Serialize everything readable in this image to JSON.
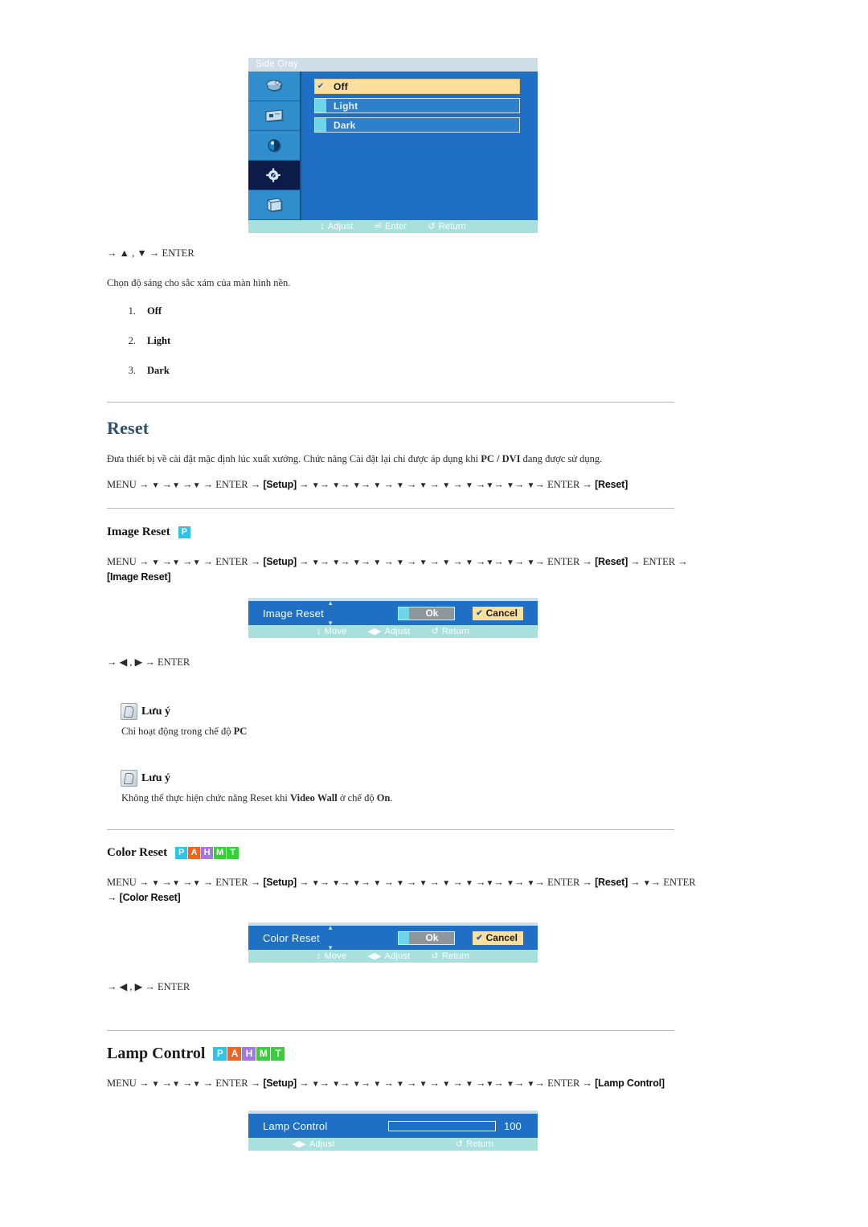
{
  "osd_side_gray": {
    "title": "Side Gray",
    "sidebar_icons": [
      "picture-icon",
      "display-icon",
      "color-icon",
      "setup-gear-icon",
      "multi-control-icon"
    ],
    "options": [
      {
        "label": "Off",
        "selected": true,
        "check": "✔"
      },
      {
        "label": "Light",
        "selected": false,
        "check": ""
      },
      {
        "label": "Dark",
        "selected": false,
        "check": ""
      }
    ],
    "statusbar": [
      {
        "glyph": "↕",
        "label": "Adjust"
      },
      {
        "glyph": "⏎",
        "label": "Enter"
      },
      {
        "glyph": "↺",
        "label": "Return"
      }
    ]
  },
  "side_gray_section": {
    "keyline": "→ ▲ , ▼ → ENTER",
    "description": "Chọn độ sáng cho sắc xám của màn hình nền.",
    "options": [
      {
        "num": "1.",
        "label": "Off"
      },
      {
        "num": "2.",
        "label": "Light"
      },
      {
        "num": "3.",
        "label": "Dark"
      }
    ]
  },
  "reset": {
    "title": "Reset",
    "description_pre": "Đưa thiết bị về cài đặt mặc định lúc xuất xưởng. Chức năng Cài đặt lại chỉ được áp dụng khi ",
    "description_bold1": "PC / DVI",
    "description_post": " đang được sử dụng.",
    "menu_label": "MENU",
    "enter_label": "ENTER",
    "setup_label": "[Setup]",
    "reset_label": "[Reset]"
  },
  "image_reset": {
    "title": "Image Reset",
    "badges": [
      {
        "letter": "P",
        "color": "#2fc3e6"
      }
    ],
    "menu_label": "MENU",
    "enter_label": "ENTER",
    "setup_label": "[Setup]",
    "reset_label": "[Reset]",
    "image_reset_label": "[Image Reset]",
    "keyline": "→ ◀ , ▶ → ENTER",
    "osd": {
      "label": "Image Reset",
      "ok_label": "Ok",
      "cancel_label": "Cancel",
      "cancel_check": "✔",
      "statusbar": [
        {
          "glyph": "↕",
          "label": "Move"
        },
        {
          "glyph": "◀▶",
          "label": "Adjust"
        },
        {
          "glyph": "↺",
          "label": "Return"
        }
      ]
    },
    "notes": [
      {
        "head": "Lưu ý",
        "body_pre": "Chỉ hoạt động trong chế độ ",
        "body_bold": "PC",
        "body_post": ""
      },
      {
        "head": "Lưu ý",
        "body_pre": "Không thể thực hiện chức năng Reset khi ",
        "body_bold": "Video Wall",
        "body_mid": " ở chế độ ",
        "body_bold2": "On",
        "body_post": "."
      }
    ]
  },
  "color_reset": {
    "title": "Color Reset",
    "badges": [
      {
        "letter": "P",
        "color": "#2fc3e6"
      },
      {
        "letter": "A",
        "color": "#ef6324"
      },
      {
        "letter": "H",
        "color": "#a476e0"
      },
      {
        "letter": "M",
        "color": "#37cf3a"
      },
      {
        "letter": "T",
        "color": "#37cf3a"
      }
    ],
    "menu_label": "MENU",
    "enter_label": "ENTER",
    "setup_label": "[Setup]",
    "reset_label": "[Reset]",
    "color_reset_label": "[Color Reset]",
    "keyline": "→ ◀ , ▶ → ENTER",
    "osd": {
      "label": "Color Reset",
      "ok_label": "Ok",
      "cancel_label": "Cancel",
      "cancel_check": "✔",
      "statusbar": [
        {
          "glyph": "↕",
          "label": "Move"
        },
        {
          "glyph": "◀▶",
          "label": "Adjust"
        },
        {
          "glyph": "↺",
          "label": "Return"
        }
      ]
    }
  },
  "lamp_control": {
    "title": "Lamp Control",
    "badges": [
      {
        "letter": "P",
        "color": "#2fc3e6"
      },
      {
        "letter": "A",
        "color": "#ef6324"
      },
      {
        "letter": "H",
        "color": "#a476e0"
      },
      {
        "letter": "M",
        "color": "#37cf3a"
      },
      {
        "letter": "T",
        "color": "#37cf3a"
      }
    ],
    "menu_label": "MENU",
    "enter_label": "ENTER",
    "setup_label": "[Setup]",
    "lamp_control_label": "[Lamp Control]",
    "osd": {
      "label": "Lamp Control",
      "value": "100",
      "fill_percent": 100,
      "statusbar": [
        {
          "glyph": "◀▶",
          "label": "Adjust"
        },
        {
          "glyph": "↺",
          "label": "Return"
        }
      ]
    }
  },
  "nav_arrows": {
    "arrow_right": "→",
    "arrow_down": "▼",
    "reset_down_count": 11,
    "lamp_down_count": 11
  },
  "colors": {
    "osd_blue": "#1f6fc4",
    "osd_sidebar_blue": "#2f8ecb",
    "osd_active_navy": "#0c1b47",
    "osd_statusbar_aqua": "#a8e0dd",
    "osd_titlebar": "#cfdde6",
    "highlight_cream": "#fbdf9f",
    "chip_cyan": "#6fd6e8",
    "slider_gold": "#e2a519",
    "heading_blue": "#2f4f6f"
  }
}
